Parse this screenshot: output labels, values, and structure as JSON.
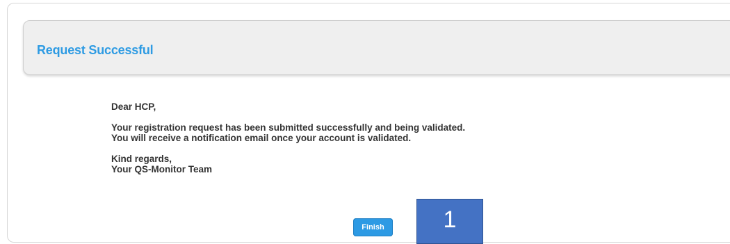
{
  "header": {
    "title": "Request Successful"
  },
  "message": {
    "greeting": "Dear HCP,",
    "body_line_1": "Your registration request has been submitted successfully and being validated.",
    "body_line_2": "You will receive a notification email once your account is validated.",
    "closing": "Kind regards,",
    "signature": "Your QS-Monitor Team"
  },
  "actions": {
    "finish_label": "Finish"
  },
  "annotation": {
    "step_number": "1"
  },
  "colors": {
    "title_blue": "#2e9be3",
    "button_blue": "#2d9ae4",
    "badge_blue": "#4472c4"
  }
}
